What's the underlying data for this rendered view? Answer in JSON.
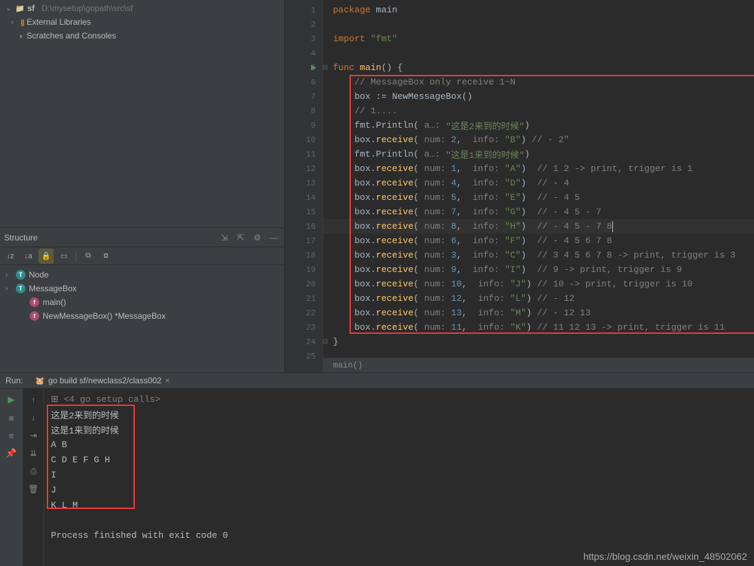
{
  "project": {
    "arrow": "⌄",
    "folder_name": "sf",
    "folder_path": "D:\\mysetup\\gopath\\src\\sf",
    "external_libs": "External Libraries",
    "scratches": "Scratches and Consoles"
  },
  "structure": {
    "title": "Structure",
    "items": [
      {
        "badge": "T",
        "cls": "t",
        "label": "Node",
        "indent": false,
        "arrow": "›"
      },
      {
        "badge": "T",
        "cls": "t",
        "label": "MessageBox",
        "indent": false,
        "arrow": "›"
      },
      {
        "badge": "f",
        "cls": "f",
        "label": "main()",
        "indent": true,
        "arrow": ""
      },
      {
        "badge": "f",
        "cls": "f",
        "label": "NewMessageBox() *MessageBox",
        "indent": true,
        "arrow": ""
      }
    ]
  },
  "editor": {
    "lines": [
      1,
      2,
      3,
      4,
      5,
      6,
      7,
      8,
      9,
      10,
      11,
      12,
      13,
      14,
      15,
      16,
      17,
      18,
      19,
      20,
      21,
      22,
      23,
      24,
      25
    ],
    "breadcrumb": "main()",
    "code": {
      "l1_kw": "package",
      "l1_txt": " main",
      "l3_kw": "import",
      "l3_str": " \"fmt\"",
      "l5_kw": "func",
      "l5_fn": " main",
      "l5_rest": "() {",
      "l6": "    // MessageBox only receive 1~N",
      "l7a": "    box := ",
      "l7b": "NewMessageBox",
      "l7c": "()",
      "l8": "    // 1....",
      "l9a": "    fmt.",
      "l9b": "Println",
      "l9c": "( ",
      "l9p": "a…: ",
      "l9s": "\"这是2来到的时候\"",
      "l9d": ")",
      "l10a": "    box.",
      "l10b": "receive",
      "l10c": "( ",
      "l10p1": "num: ",
      "l10n": "2",
      "l10d1": ",  ",
      "l10p2": "info: ",
      "l10s": "\"B\"",
      "l10d2": ") ",
      "l10cmt": "// - 2\"",
      "l11a": "    fmt.",
      "l11b": "Println",
      "l11c": "( ",
      "l11p": "a…: ",
      "l11s": "\"这是1来到的时候\"",
      "l11d": ")",
      "l12a": "    box.",
      "l12b": "receive",
      "l12c": "( ",
      "l12p1": "num: ",
      "l12n": "1",
      "l12d1": ",  ",
      "l12p2": "info: ",
      "l12s": "\"A\"",
      "l12d2": ")  ",
      "l12cmt": "// 1 2 -> print, trigger is 1",
      "l13a": "    box.",
      "l13b": "receive",
      "l13c": "( ",
      "l13p1": "num: ",
      "l13n": "4",
      "l13d1": ",  ",
      "l13p2": "info: ",
      "l13s": "\"D\"",
      "l13d2": ")  ",
      "l13cmt": "// - 4",
      "l14a": "    box.",
      "l14b": "receive",
      "l14c": "( ",
      "l14p1": "num: ",
      "l14n": "5",
      "l14d1": ",  ",
      "l14p2": "info: ",
      "l14s": "\"E\"",
      "l14d2": ")  ",
      "l14cmt": "// - 4 5",
      "l15a": "    box.",
      "l15b": "receive",
      "l15c": "( ",
      "l15p1": "num: ",
      "l15n": "7",
      "l15d1": ",  ",
      "l15p2": "info: ",
      "l15s": "\"G\"",
      "l15d2": ")  ",
      "l15cmt": "// - 4 5 - 7",
      "l16a": "    box.",
      "l16b": "receive",
      "l16c": "( ",
      "l16p1": "num: ",
      "l16n": "8",
      "l16d1": ",  ",
      "l16p2": "info: ",
      "l16s": "\"H\"",
      "l16d2": ")  ",
      "l16cmt": "// - 4 5 - 7 8",
      "l17a": "    box.",
      "l17b": "receive",
      "l17c": "( ",
      "l17p1": "num: ",
      "l17n": "6",
      "l17d1": ",  ",
      "l17p2": "info: ",
      "l17s": "\"F\"",
      "l17d2": ")  ",
      "l17cmt": "// - 4 5 6 7 8",
      "l18a": "    box.",
      "l18b": "receive",
      "l18c": "( ",
      "l18p1": "num: ",
      "l18n": "3",
      "l18d1": ",  ",
      "l18p2": "info: ",
      "l18s": "\"C\"",
      "l18d2": ")  ",
      "l18cmt": "// 3 4 5 6 7 8 -> print, trigger is 3",
      "l19a": "    box.",
      "l19b": "receive",
      "l19c": "( ",
      "l19p1": "num: ",
      "l19n": "9",
      "l19d1": ",  ",
      "l19p2": "info: ",
      "l19s": "\"I\"",
      "l19d2": ")  ",
      "l19cmt": "// 9 -> print, trigger is 9",
      "l20a": "    box.",
      "l20b": "receive",
      "l20c": "( ",
      "l20p1": "num: ",
      "l20n": "10",
      "l20d1": ",  ",
      "l20p2": "info: ",
      "l20s": "\"J\"",
      "l20d2": ") ",
      "l20cmt": "// 10 -> print, trigger is 10",
      "l21a": "    box.",
      "l21b": "receive",
      "l21c": "( ",
      "l21p1": "num: ",
      "l21n": "12",
      "l21d1": ",  ",
      "l21p2": "info: ",
      "l21s": "\"L\"",
      "l21d2": ") ",
      "l21cmt": "// - 12",
      "l22a": "    box.",
      "l22b": "receive",
      "l22c": "( ",
      "l22p1": "num: ",
      "l22n": "13",
      "l22d1": ",  ",
      "l22p2": "info: ",
      "l22s": "\"M\"",
      "l22d2": ") ",
      "l22cmt": "// - 12 13",
      "l23a": "    box.",
      "l23b": "receive",
      "l23c": "( ",
      "l23p1": "num: ",
      "l23n": "11",
      "l23d1": ",  ",
      "l23p2": "info: ",
      "l23s": "\"K\"",
      "l23d2": ") ",
      "l23cmt": "// 11 12 13 -> print, trigger is 11",
      "l24": "}"
    }
  },
  "run": {
    "label": "Run:",
    "tab_label": "go build sf/newclass2/class002",
    "console": [
      {
        "t": "<4 go setup calls>",
        "muted": true,
        "fold": "⊞"
      },
      {
        "t": "这是2来到的时候"
      },
      {
        "t": "这是1来到的时候"
      },
      {
        "t": "A B"
      },
      {
        "t": "C D E F G H"
      },
      {
        "t": "I"
      },
      {
        "t": "J"
      },
      {
        "t": "K L M"
      },
      {
        "t": ""
      },
      {
        "t": "Process finished with exit code 0"
      }
    ]
  },
  "watermark": "https://blog.csdn.net/weixin_48502062"
}
